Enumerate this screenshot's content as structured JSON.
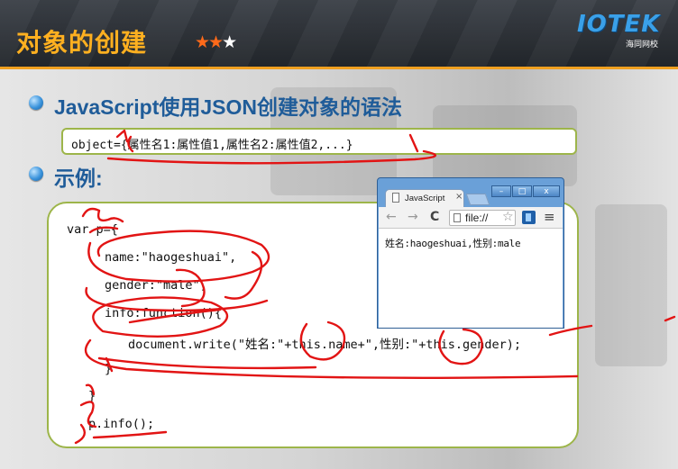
{
  "header": {
    "title": "对象的创建",
    "stars": {
      "filled": "★★",
      "empty": "★"
    },
    "logo": {
      "text": "IOTEK",
      "subtitle": "海同网校"
    }
  },
  "bullets": [
    {
      "heading": "JavaScript使用JSON创建对象的语法"
    },
    {
      "heading": "示例:"
    }
  ],
  "syntax": "object={属性名1:属性值1,属性名2:属性值2,...}",
  "code_lines": [
    "var p={",
    "name:\"haogeshuai\",",
    "gender:\"male\",",
    "info:function(){",
    "document.write(\"姓名:\"+this.name+\",性别:\"+this.gender);",
    "}",
    "}",
    "p.info();"
  ],
  "browser": {
    "tab_title": "JavaScript",
    "tab_close": "×",
    "window_buttons": {
      "minimize": "–",
      "maximize": "□",
      "close": "x"
    },
    "nav": {
      "back": "←",
      "forward": "→",
      "reload": "C"
    },
    "address": "file://",
    "bookmark_star": "☆",
    "menu": "≡",
    "page_output": "姓名:haogeshuai,性别:male"
  },
  "colors": {
    "title": "#ffb020",
    "heading": "#1f5c99",
    "box_border": "#9db54a",
    "annotation_ink": "#e21414",
    "logo": "#3aa0e8"
  }
}
